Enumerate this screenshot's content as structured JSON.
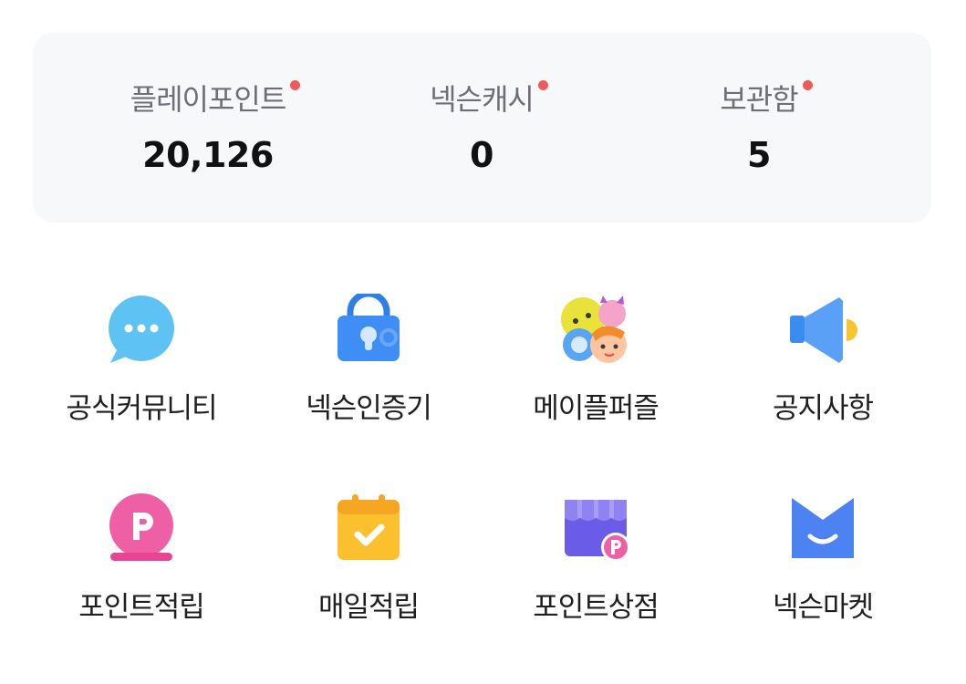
{
  "summary": {
    "items": [
      {
        "label": "플레이포인트",
        "value": "20,126",
        "dot_color": "#ec5b5b"
      },
      {
        "label": "넥슨캐시",
        "value": "0",
        "dot_color": "#ec5b5b"
      },
      {
        "label": "보관함",
        "value": "5",
        "dot_color": "#ec5b5b"
      }
    ]
  },
  "menu": {
    "items": [
      {
        "label": "공식커뮤니티",
        "icon": "chat-bubble-icon"
      },
      {
        "label": "넥슨인증기",
        "icon": "lock-icon"
      },
      {
        "label": "메이플퍼즐",
        "icon": "puzzle-characters-icon"
      },
      {
        "label": "공지사항",
        "icon": "megaphone-icon"
      },
      {
        "label": "포인트적립",
        "icon": "point-coin-icon"
      },
      {
        "label": "매일적립",
        "icon": "calendar-check-icon"
      },
      {
        "label": "포인트상점",
        "icon": "point-shop-icon"
      },
      {
        "label": "넥슨마켓",
        "icon": "market-bag-icon"
      }
    ]
  },
  "colors": {
    "card_bg": "#f7f8fa",
    "label_gray": "#6d6f76",
    "dot_red": "#ec5b5b"
  }
}
